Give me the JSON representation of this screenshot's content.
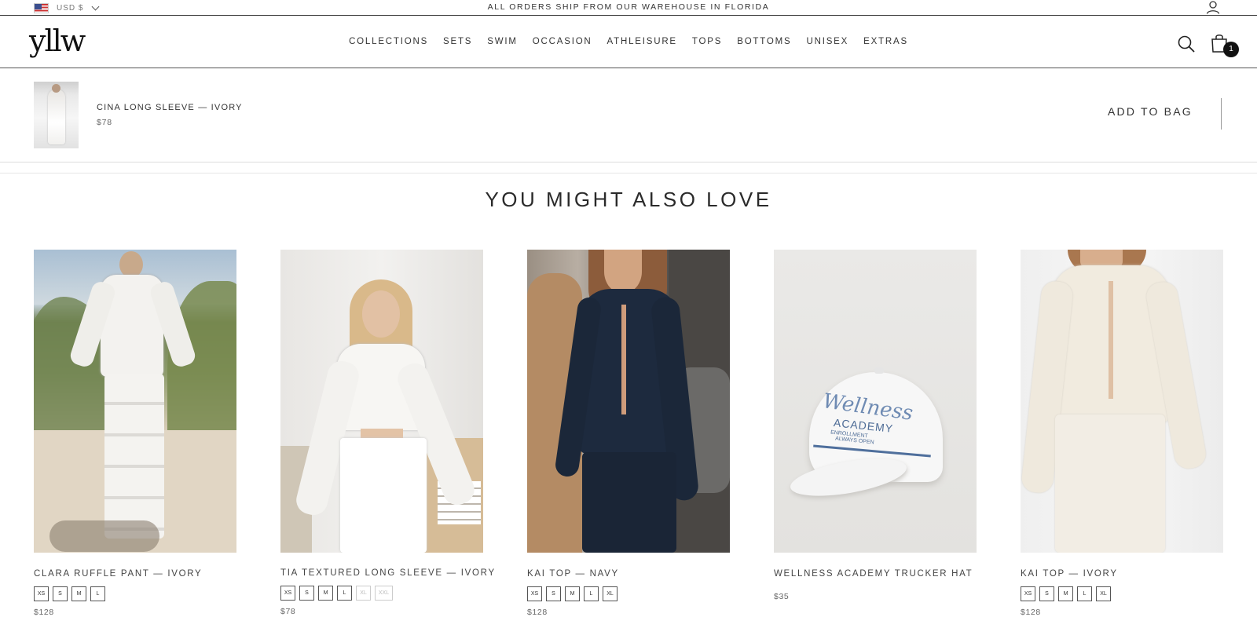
{
  "announcement": {
    "currency": "USD $",
    "message": "ALL ORDERS SHIP FROM OUR WAREHOUSE IN FLORIDA"
  },
  "header": {
    "logo": "yllw",
    "nav": [
      "COLLECTIONS",
      "SETS",
      "SWIM",
      "OCCASION",
      "ATHLEISURE",
      "TOPS",
      "BOTTOMS",
      "UNISEX",
      "EXTRAS"
    ],
    "cart_count": "1"
  },
  "sticky_bar": {
    "product_name": "CINA LONG SLEEVE — IVORY",
    "price": "$78",
    "add_to_bag_label": "ADD TO BAG"
  },
  "recommendations": {
    "title": "YOU MIGHT ALSO LOVE",
    "products": [
      {
        "name": "CLARA RUFFLE PANT — IVORY",
        "sizes": [
          {
            "label": "XS",
            "available": true
          },
          {
            "label": "S",
            "available": true
          },
          {
            "label": "M",
            "available": true
          },
          {
            "label": "L",
            "available": true
          }
        ],
        "price": "$128"
      },
      {
        "name": "TIA TEXTURED LONG SLEEVE — IVORY",
        "sizes": [
          {
            "label": "XS",
            "available": true
          },
          {
            "label": "S",
            "available": true
          },
          {
            "label": "M",
            "available": true
          },
          {
            "label": "L",
            "available": true
          },
          {
            "label": "XL",
            "available": false
          },
          {
            "label": "XXL",
            "available": false
          }
        ],
        "price": "$78"
      },
      {
        "name": "KAI TOP — NAVY",
        "sizes": [
          {
            "label": "XS",
            "available": true
          },
          {
            "label": "S",
            "available": true
          },
          {
            "label": "M",
            "available": true
          },
          {
            "label": "L",
            "available": true
          },
          {
            "label": "XL",
            "available": true
          }
        ],
        "price": "$128"
      },
      {
        "name": "WELLNESS ACADEMY TRUCKER HAT",
        "sizes": [],
        "price": "$35",
        "hat_text": [
          "Wellness",
          "ACADEMY",
          "ENROLLMENT",
          "ALWAYS OPEN"
        ]
      },
      {
        "name": "KAI TOP — IVORY",
        "sizes": [
          {
            "label": "XS",
            "available": true
          },
          {
            "label": "S",
            "available": true
          },
          {
            "label": "M",
            "available": true
          },
          {
            "label": "L",
            "available": true
          },
          {
            "label": "XL",
            "available": true
          }
        ],
        "price": "$128"
      }
    ]
  },
  "icons": {
    "flag": "us-flag-icon",
    "dropdown": "chevron-down-icon",
    "account": "user-icon",
    "search": "search-icon",
    "cart": "shopping-bag-icon"
  }
}
